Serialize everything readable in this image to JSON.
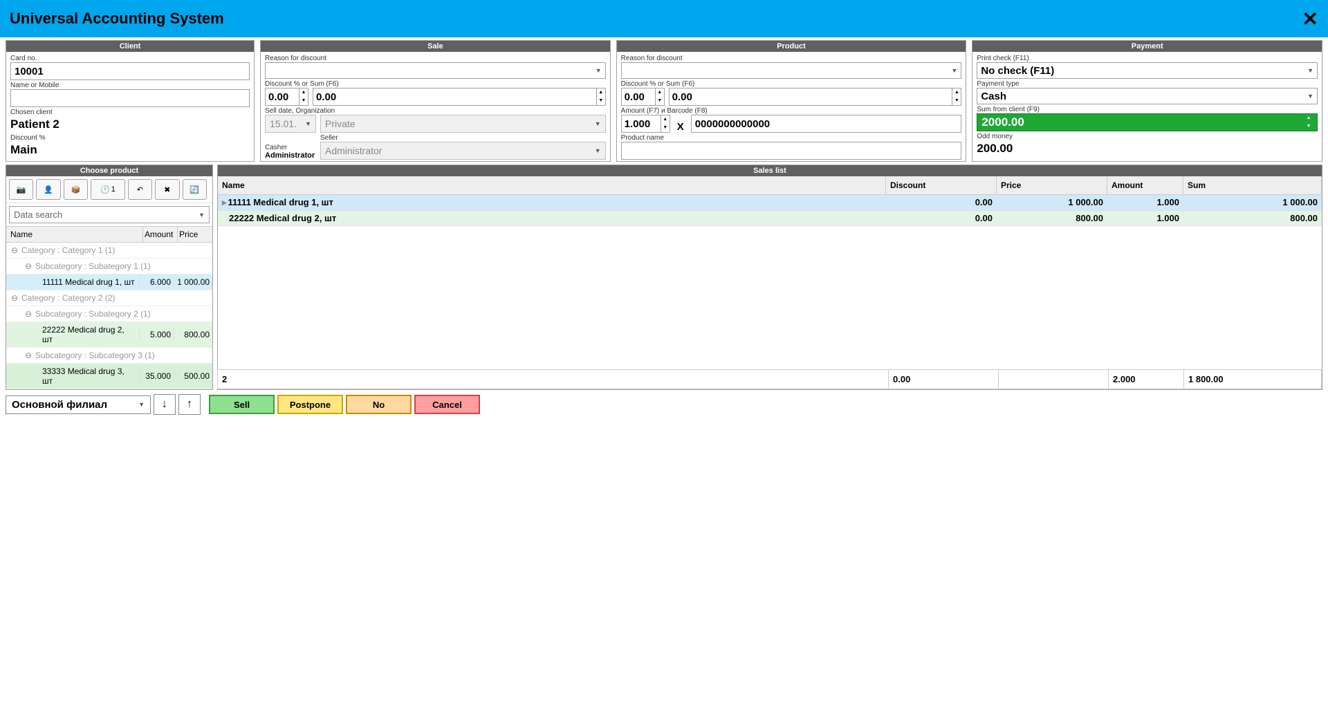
{
  "title": "Universal Accounting System",
  "client": {
    "header": "Client",
    "card_label": "Card no.",
    "card_value": "10001",
    "name_label": "Name or Mobile",
    "name_value": "",
    "chosen_label": "Chosen client",
    "chosen_value": "Patient 2",
    "discount_label": "Discount %",
    "discount_value": "Main"
  },
  "sale": {
    "header": "Sale",
    "reason_label": "Reason for discount",
    "reason_value": "",
    "disc_label": "Discount % or Sum (F6)",
    "disc_pct": "0.00",
    "disc_sum": "0.00",
    "date_label": "Sell date, Organization",
    "date_value": "15.01.",
    "org_value": "Private",
    "cashier_label": "Casher",
    "cashier_value": "Administrator",
    "seller_label": "Seller",
    "seller_value": "Administrator"
  },
  "product": {
    "header": "Product",
    "reason_label": "Reason for discount",
    "reason_value": "",
    "disc_label": "Discount % or Sum (F6)",
    "disc_pct": "0.00",
    "disc_sum": "0.00",
    "amount_label": "Amount (F7) и Barcode (F8)",
    "amount_value": "1.000",
    "barcode_value": "0000000000000",
    "name_label": "Product name",
    "name_value": ""
  },
  "payment": {
    "header": "Payment",
    "print_label": "Print check (F11)",
    "print_value": "No check (F11)",
    "type_label": "Payment type",
    "type_value": "Cash",
    "sum_label": "Sum from client (F9)",
    "sum_value": "2000.00",
    "odd_label": "Odd money",
    "odd_value": "200.00"
  },
  "choose": {
    "header": "Choose product",
    "search_placeholder": "Data search",
    "col_name": "Name",
    "col_amount": "Amount",
    "col_price": "Price",
    "cat1": "Category : Category 1 (1)",
    "sub1": "Subcategory : Subategory 1 (1)",
    "p1_name": "11111 Medical drug 1, шт",
    "p1_amt": "6.000",
    "p1_price": "1 000.00",
    "cat2": "Category : Category 2 (2)",
    "sub2": "Subcategory : Subategory 2 (1)",
    "p2_name": "22222 Medical drug 2, шт",
    "p2_amt": "5.000",
    "p2_price": "800.00",
    "sub3": "Subcategory : Subcategory 3 (1)",
    "p3_name": "33333 Medical drug 3, шт",
    "p3_amt": "35.000",
    "p3_price": "500.00"
  },
  "sales": {
    "header": "Sales list",
    "col_name": "Name",
    "col_disc": "Discount",
    "col_price": "Price",
    "col_amt": "Amount",
    "col_sum": "Sum",
    "rows": [
      {
        "name": "11111 Medical drug 1, шт",
        "disc": "0.00",
        "price": "1 000.00",
        "amt": "1.000",
        "sum": "1 000.00"
      },
      {
        "name": "22222 Medical drug 2, шт",
        "disc": "0.00",
        "price": "800.00",
        "amt": "1.000",
        "sum": "800.00"
      }
    ],
    "foot_count": "2",
    "foot_disc": "0.00",
    "foot_amt": "2.000",
    "foot_sum": "1 800.00"
  },
  "bottom": {
    "branch": "Основной филиал",
    "sell": "Sell",
    "postpone": "Postpone",
    "no": "No",
    "cancel": "Cancel"
  },
  "toolbar_count": "1"
}
